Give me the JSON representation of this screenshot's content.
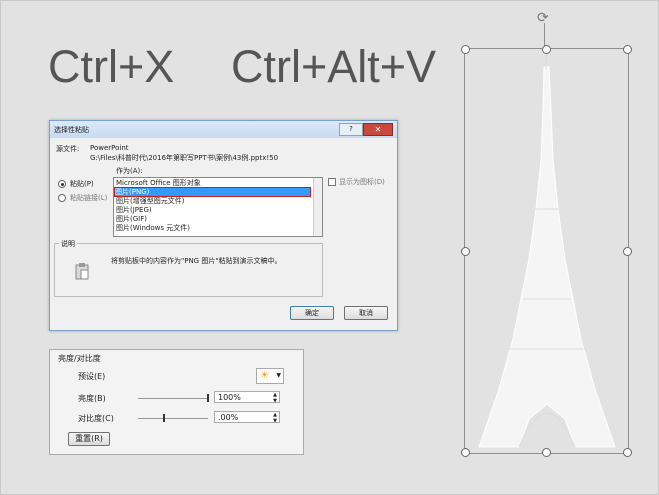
{
  "slide": {
    "shortcut_cut": "Ctrl+X",
    "shortcut_paste": "Ctrl+Alt+V"
  },
  "dialog": {
    "title": "选择性粘贴",
    "help_label": "?",
    "close_label": "✕",
    "source_label": "源文件:",
    "source_app": "PowerPoint",
    "source_path": "G:\\Files\\科普时代\\2016年第职写PPT书\\案例\\43例.pptx!50",
    "as_label": "作为(A):",
    "paste_label": "粘贴(P)",
    "paste_link_label": "粘贴链接(L)",
    "list_items": [
      "Microsoft Office 图形对象",
      "图片(PNG)",
      "图片(增强型图元文件)",
      "图片(JPEG)",
      "图片(GIF)",
      "图片(Windows 元文件)"
    ],
    "selected_index": 1,
    "display_as_icon_label": "显示为图标(D)",
    "description_label": "说明",
    "description_text": "将剪贴板中的内容作为\"PNG 图片\"粘贴到演示文稿中。",
    "ok_label": "确定",
    "cancel_label": "取消"
  },
  "brightness_panel": {
    "title": "亮度/对比度",
    "preset_label": "预设(E)",
    "preset_icon": "sun-icon",
    "brightness_label": "亮度(B)",
    "brightness_value": "100%",
    "contrast_label": "对比度(C)",
    "contrast_value": ".00%",
    "reset_label": "重置(R)"
  },
  "image": {
    "name": "eiffel-tower-picture",
    "rotate_icon": "rotate-icon"
  }
}
